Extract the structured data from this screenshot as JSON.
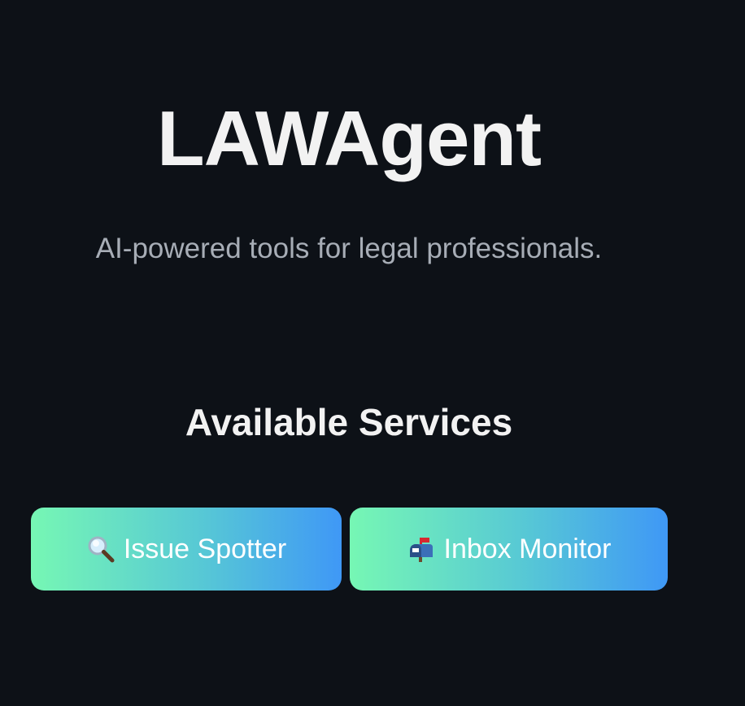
{
  "app": {
    "title": "LAWAgent",
    "tagline": "AI-powered tools for legal professionals."
  },
  "services": {
    "heading": "Available Services",
    "items": [
      {
        "label": "Issue Spotter",
        "icon": "magnifying-glass-icon"
      },
      {
        "label": "Inbox Monitor",
        "icon": "mailbox-icon"
      }
    ]
  },
  "colors": {
    "background": "#0d1117",
    "text_primary": "#f2f2f2",
    "text_muted": "#a7adb6",
    "gradient_start": "#76f7b4",
    "gradient_end": "#3f98f6"
  }
}
